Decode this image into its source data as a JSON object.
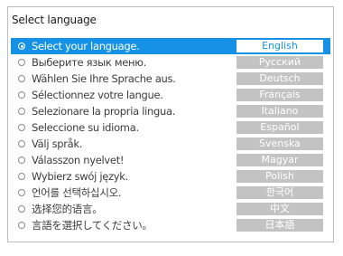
{
  "dialog": {
    "title": "Select language"
  },
  "languages": [
    {
      "prompt": "Select your language.",
      "name": "English",
      "selected": true
    },
    {
      "prompt": "Выберите язык меню.",
      "name": "Русский",
      "selected": false
    },
    {
      "prompt": "Wählen Sie Ihre Sprache aus.",
      "name": "Deutsch",
      "selected": false
    },
    {
      "prompt": "Sélectionnez votre langue.",
      "name": "Français",
      "selected": false
    },
    {
      "prompt": "Selezionare la propria lingua.",
      "name": "Italiano",
      "selected": false
    },
    {
      "prompt": "Seleccione su idioma.",
      "name": "Español",
      "selected": false
    },
    {
      "prompt": "Välj språk.",
      "name": "Svenska",
      "selected": false
    },
    {
      "prompt": "Válasszon nyelvet!",
      "name": "Magyar",
      "selected": false
    },
    {
      "prompt": "Wybierz swój język.",
      "name": "Polish",
      "selected": false
    },
    {
      "prompt": "언어를 선택하십시오.",
      "name": "한국어",
      "selected": false
    },
    {
      "prompt": "选择您的语言。",
      "name": "中文",
      "selected": false
    },
    {
      "prompt": "言語を選択してください。",
      "name": "日本語",
      "selected": false
    }
  ],
  "colors": {
    "selection": "#1592e6",
    "badge": "#c3c3c3",
    "border": "#b9bdc3"
  }
}
